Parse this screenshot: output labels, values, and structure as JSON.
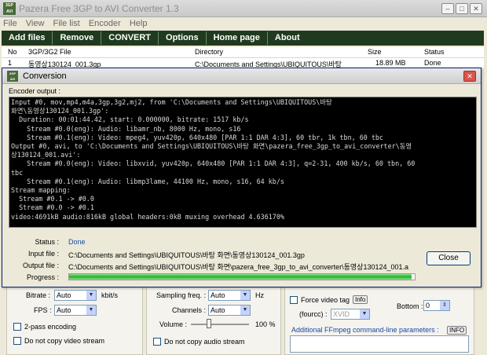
{
  "window": {
    "title": "Pazera Free 3GP to AVI Converter 1.3",
    "icon_text": "3GP AVI",
    "minimize_glyph": "–",
    "maximize_glyph": "□",
    "close_glyph": "✕"
  },
  "menu": [
    "File",
    "View",
    "File list",
    "Encoder",
    "Help"
  ],
  "toolbar": [
    "Add files",
    "Remove",
    "CONVERT",
    "Options",
    "Home page",
    "About"
  ],
  "file_table": {
    "headers": {
      "no": "No",
      "file": "3GP/3G2 File",
      "directory": "Directory",
      "size": "Size",
      "status": "Status"
    },
    "rows": [
      {
        "no": "1",
        "file": "동영상130124_001.3gp",
        "directory": "C:\\Documents and Settings\\UBIQUITOUS\\바탕",
        "size": "18.89 MB",
        "status": "Done"
      }
    ]
  },
  "dialog": {
    "title": "Conversion",
    "encoder_output_label": "Encoder output :",
    "console_lines": [
      "Input #0, mov,mp4,m4a,3gp,3g2,mj2, from 'C:\\Documents and Settings\\UBIQUITOUS\\바탕",
      "화면\\동영상130124_001.3gp':",
      "  Duration: 00:01:44.42, start: 0.000000, bitrate: 1517 kb/s",
      "    Stream #0.0(eng): Audio: libamr_nb, 8000 Hz, mono, s16",
      "    Stream #0.1(eng): Video: mpeg4, yuv420p, 640x480 [PAR 1:1 DAR 4:3], 60 tbr, 1k tbn, 60 tbc",
      "Output #0, avi, to 'C:\\Documents and Settings\\UBIQUITOUS\\바탕 화면\\pazera_free_3gp_to_avi_converter\\동영",
      "상130124_001.avi':",
      "    Stream #0.0(eng): Video: libxvid, yuv420p, 640x480 [PAR 1:1 DAR 4:3], q=2-31, 400 kb/s, 60 tbn, 60",
      "tbc",
      "    Stream #0.1(eng): Audio: libmp3lame, 44100 Hz, mono, s16, 64 kb/s",
      "Stream mapping:",
      "  Stream #0.1 -> #0.0",
      "  Stream #0.0 -> #0.1",
      "video:4691kB audio:816kB global headers:0kB muxing overhead 4.636170%"
    ],
    "status_label": "Status :",
    "status_value": "Done",
    "input_label": "Input file :",
    "input_value": "C:\\Documents and Settings\\UBIQUITOUS\\바탕 화면\\동영상130124_001.3gp",
    "output_label": "Output file :",
    "output_value": "C:\\Documents and Settings\\UBIQUITOUS\\바탕 화면\\pazera_free_3gp_to_avi_converter\\동영상130124_001.a",
    "progress_label": "Progress :",
    "progress_fraction": 0.99,
    "close_label": "Close"
  },
  "video_settings": {
    "bitrate_label": "Bitrate :",
    "bitrate_value": "Auto",
    "bitrate_unit": "kbit/s",
    "fps_label": "FPS :",
    "fps_value": "Auto",
    "two_pass_label": "2-pass encoding",
    "no_copy_video_label": "Do not copy video stream"
  },
  "audio_settings": {
    "sampling_label": "Sampling freq. :",
    "sampling_value": "Auto",
    "sampling_unit": "Hz",
    "channels_label": "Channels :",
    "channels_value": "Auto",
    "volume_label": "Volume :",
    "volume_value": "100 %",
    "no_copy_audio_label": "Do not copy audio stream"
  },
  "extra_settings": {
    "force_tag_label": "Force video tag",
    "info_label": "Info",
    "fourcc_label": "(fourcc) :",
    "fourcc_value": "XVID",
    "bottom_label": "Bottom :",
    "bottom_value": "0",
    "ffmpeg_params_label": "Additional FFmpeg command-line parameters :",
    "info_upper_label": "INFO"
  }
}
